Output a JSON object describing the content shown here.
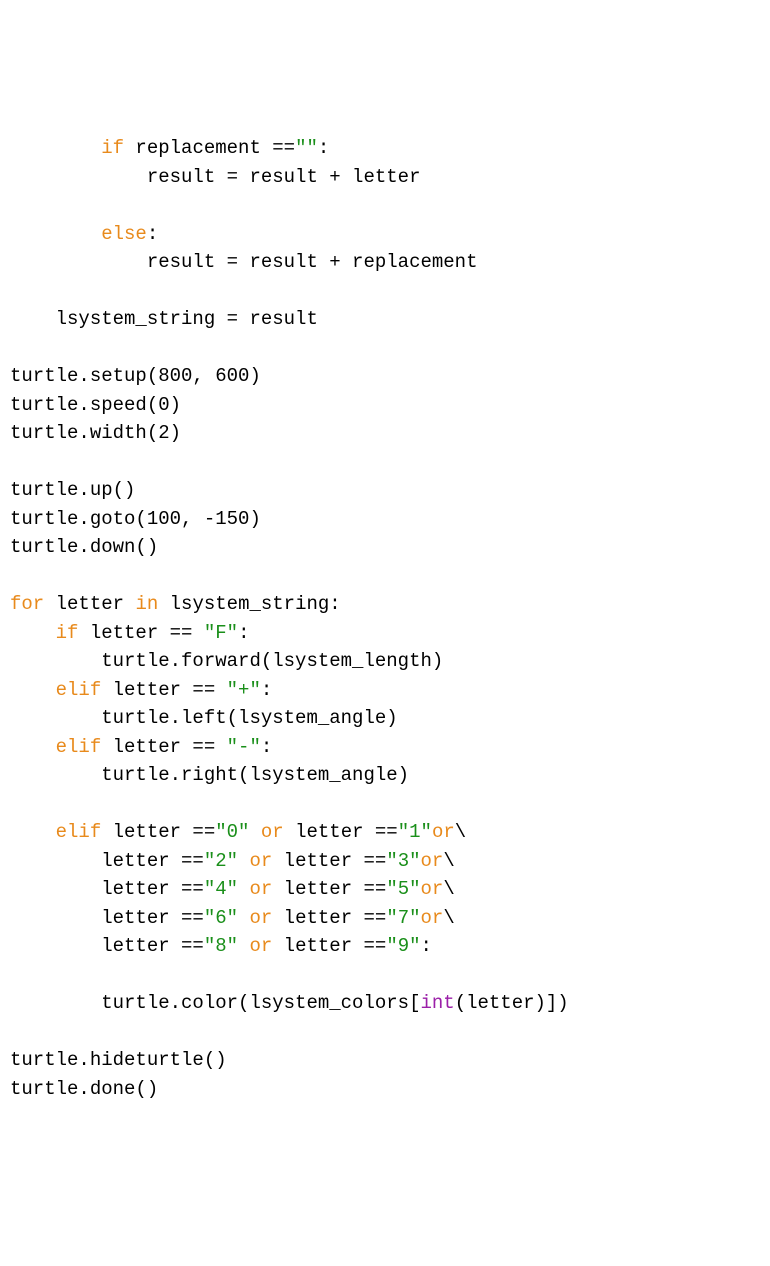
{
  "code": {
    "tokens": [
      {
        "t": "        ",
        "c": "plain"
      },
      {
        "t": "if",
        "c": "kw"
      },
      {
        "t": " replacement ==",
        "c": "plain"
      },
      {
        "t": "\"\"",
        "c": "str"
      },
      {
        "t": ":",
        "c": "plain"
      },
      {
        "t": "\n",
        "c": "plain"
      },
      {
        "t": "            result = result + letter",
        "c": "plain"
      },
      {
        "t": "\n",
        "c": "plain"
      },
      {
        "t": "\n",
        "c": "plain"
      },
      {
        "t": "        ",
        "c": "plain"
      },
      {
        "t": "else",
        "c": "kw"
      },
      {
        "t": ":",
        "c": "plain"
      },
      {
        "t": "\n",
        "c": "plain"
      },
      {
        "t": "            result = result + replacement",
        "c": "plain"
      },
      {
        "t": "\n",
        "c": "plain"
      },
      {
        "t": "\n",
        "c": "plain"
      },
      {
        "t": "    lsystem_string = result",
        "c": "plain"
      },
      {
        "t": "\n",
        "c": "plain"
      },
      {
        "t": "\n",
        "c": "plain"
      },
      {
        "t": "turtle.setup(800, 600)",
        "c": "plain"
      },
      {
        "t": "\n",
        "c": "plain"
      },
      {
        "t": "turtle.speed(0)",
        "c": "plain"
      },
      {
        "t": "\n",
        "c": "plain"
      },
      {
        "t": "turtle.width(2)",
        "c": "plain"
      },
      {
        "t": "\n",
        "c": "plain"
      },
      {
        "t": "\n",
        "c": "plain"
      },
      {
        "t": "turtle.up()",
        "c": "plain"
      },
      {
        "t": "\n",
        "c": "plain"
      },
      {
        "t": "turtle.goto(100, -150)",
        "c": "plain"
      },
      {
        "t": "\n",
        "c": "plain"
      },
      {
        "t": "turtle.down()",
        "c": "plain"
      },
      {
        "t": "\n",
        "c": "plain"
      },
      {
        "t": "\n",
        "c": "plain"
      },
      {
        "t": "for",
        "c": "kw"
      },
      {
        "t": " letter ",
        "c": "plain"
      },
      {
        "t": "in",
        "c": "kw"
      },
      {
        "t": " lsystem_string:",
        "c": "plain"
      },
      {
        "t": "\n",
        "c": "plain"
      },
      {
        "t": "    ",
        "c": "plain"
      },
      {
        "t": "if",
        "c": "kw"
      },
      {
        "t": " letter == ",
        "c": "plain"
      },
      {
        "t": "\"F\"",
        "c": "str"
      },
      {
        "t": ":",
        "c": "plain"
      },
      {
        "t": "\n",
        "c": "plain"
      },
      {
        "t": "        turtle.forward(lsystem_length)",
        "c": "plain"
      },
      {
        "t": "\n",
        "c": "plain"
      },
      {
        "t": "    ",
        "c": "plain"
      },
      {
        "t": "elif",
        "c": "kw"
      },
      {
        "t": " letter == ",
        "c": "plain"
      },
      {
        "t": "\"+\"",
        "c": "str"
      },
      {
        "t": ":",
        "c": "plain"
      },
      {
        "t": "\n",
        "c": "plain"
      },
      {
        "t": "        turtle.left(lsystem_angle)",
        "c": "plain"
      },
      {
        "t": "\n",
        "c": "plain"
      },
      {
        "t": "    ",
        "c": "plain"
      },
      {
        "t": "elif",
        "c": "kw"
      },
      {
        "t": " letter == ",
        "c": "plain"
      },
      {
        "t": "\"-\"",
        "c": "str"
      },
      {
        "t": ":",
        "c": "plain"
      },
      {
        "t": "\n",
        "c": "plain"
      },
      {
        "t": "        turtle.right(lsystem_angle)",
        "c": "plain"
      },
      {
        "t": "\n",
        "c": "plain"
      },
      {
        "t": "\n",
        "c": "plain"
      },
      {
        "t": "    ",
        "c": "plain"
      },
      {
        "t": "elif",
        "c": "kw"
      },
      {
        "t": " letter ==",
        "c": "plain"
      },
      {
        "t": "\"0\"",
        "c": "str"
      },
      {
        "t": " ",
        "c": "plain"
      },
      {
        "t": "or",
        "c": "kw"
      },
      {
        "t": " letter ==",
        "c": "plain"
      },
      {
        "t": "\"1\"",
        "c": "str"
      },
      {
        "t": "or",
        "c": "kw"
      },
      {
        "t": "\\",
        "c": "plain"
      },
      {
        "t": "\n",
        "c": "plain"
      },
      {
        "t": "        letter ==",
        "c": "plain"
      },
      {
        "t": "\"2\"",
        "c": "str"
      },
      {
        "t": " ",
        "c": "plain"
      },
      {
        "t": "or",
        "c": "kw"
      },
      {
        "t": " letter ==",
        "c": "plain"
      },
      {
        "t": "\"3\"",
        "c": "str"
      },
      {
        "t": "or",
        "c": "kw"
      },
      {
        "t": "\\",
        "c": "plain"
      },
      {
        "t": "\n",
        "c": "plain"
      },
      {
        "t": "        letter ==",
        "c": "plain"
      },
      {
        "t": "\"4\"",
        "c": "str"
      },
      {
        "t": " ",
        "c": "plain"
      },
      {
        "t": "or",
        "c": "kw"
      },
      {
        "t": " letter ==",
        "c": "plain"
      },
      {
        "t": "\"5\"",
        "c": "str"
      },
      {
        "t": "or",
        "c": "kw"
      },
      {
        "t": "\\",
        "c": "plain"
      },
      {
        "t": "\n",
        "c": "plain"
      },
      {
        "t": "        letter ==",
        "c": "plain"
      },
      {
        "t": "\"6\"",
        "c": "str"
      },
      {
        "t": " ",
        "c": "plain"
      },
      {
        "t": "or",
        "c": "kw"
      },
      {
        "t": " letter ==",
        "c": "plain"
      },
      {
        "t": "\"7\"",
        "c": "str"
      },
      {
        "t": "or",
        "c": "kw"
      },
      {
        "t": "\\",
        "c": "plain"
      },
      {
        "t": "\n",
        "c": "plain"
      },
      {
        "t": "        letter ==",
        "c": "plain"
      },
      {
        "t": "\"8\"",
        "c": "str"
      },
      {
        "t": " ",
        "c": "plain"
      },
      {
        "t": "or",
        "c": "kw"
      },
      {
        "t": " letter ==",
        "c": "plain"
      },
      {
        "t": "\"9\"",
        "c": "str"
      },
      {
        "t": ":",
        "c": "plain"
      },
      {
        "t": "\n",
        "c": "plain"
      },
      {
        "t": "\n",
        "c": "plain"
      },
      {
        "t": "        turtle.color(lsystem_colors[",
        "c": "plain"
      },
      {
        "t": "int",
        "c": "builtin"
      },
      {
        "t": "(letter)])",
        "c": "plain"
      },
      {
        "t": "\n",
        "c": "plain"
      },
      {
        "t": "\n",
        "c": "plain"
      },
      {
        "t": "turtle.hideturtle()",
        "c": "plain"
      },
      {
        "t": "\n",
        "c": "plain"
      },
      {
        "t": "turtle.done()",
        "c": "plain"
      }
    ]
  }
}
